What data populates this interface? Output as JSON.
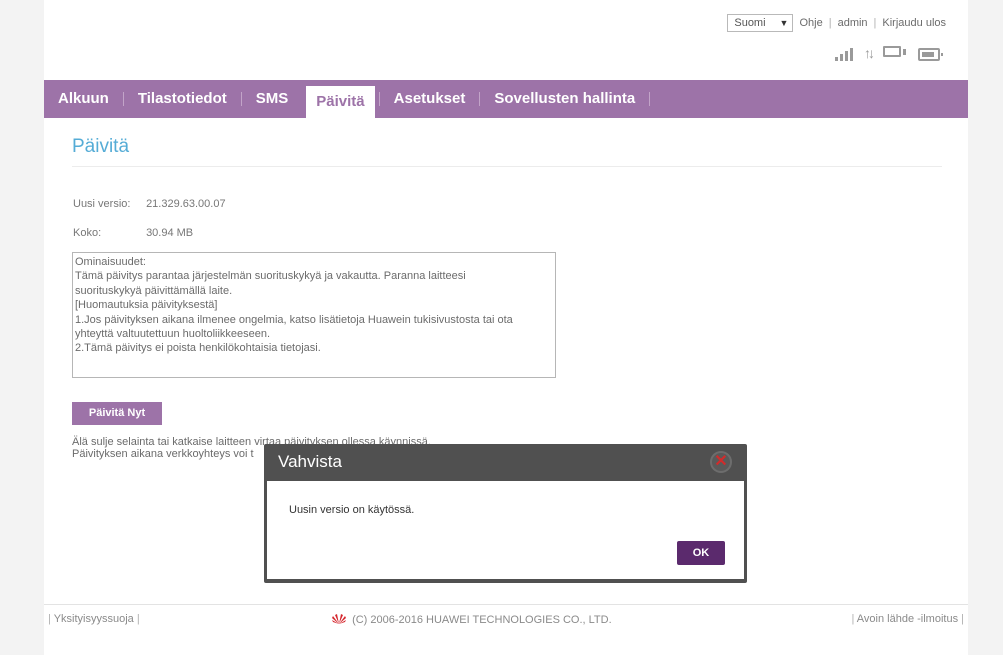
{
  "topbar": {
    "language": "Suomi",
    "help": "Ohje",
    "user": "admin",
    "logout": "Kirjaudu ulos"
  },
  "status": {
    "signal_icon": "signal-bars-icon",
    "data_icon": "up-down-arrows-icon",
    "connection_icon": "monitor-icon",
    "battery_icon": "battery-icon"
  },
  "nav": {
    "items": [
      "Alkuun",
      "Tilastotiedot",
      "SMS",
      "Päivitä",
      "Asetukset",
      "Sovellusten hallinta"
    ],
    "active": "Päivitä"
  },
  "main": {
    "title": "Päivitä",
    "new_version_label": "Uusi versio:",
    "new_version_value": "21.329.63.00.07",
    "size_label": "Koko:",
    "size_value": "30.94 MB",
    "notes": [
      "Ominaisuudet:",
      "Tämä päivitys parantaa järjestelmän suorituskykyä ja vakautta. Paranna laitteesi",
      "suorituskykyä päivittämällä laite.",
      "[Huomautuksia päivityksestä]",
      "1.Jos päivityksen aikana ilmenee ongelmia, katso lisätietoja Huawein tukisivustosta tai ota",
      "yhteyttä valtuutettuun huoltoliikkeeseen.",
      "2.Tämä päivitys ei poista henkilökohtaisia tietojasi."
    ],
    "update_button": "Päivitä Nyt",
    "warning_line1": "Älä sulje selainta tai katkaise laitteen virtaa päivityksen ollessa käynnissä.",
    "warning_line2": "Päivityksen aikana verkkoyhteys voi t"
  },
  "dialog": {
    "title": "Vahvista",
    "message": "Uusin versio on käytössä.",
    "ok": "OK"
  },
  "footer": {
    "privacy": "Yksityisyyssuoja",
    "copyright": "(C) 2006-2016 HUAWEI TECHNOLOGIES CO., LTD.",
    "open_source": "Avoin lähde -ilmoitus"
  },
  "colors": {
    "nav_bg": "#9d73a8",
    "title": "#55acd6",
    "ok_button": "#5b2a6d"
  }
}
